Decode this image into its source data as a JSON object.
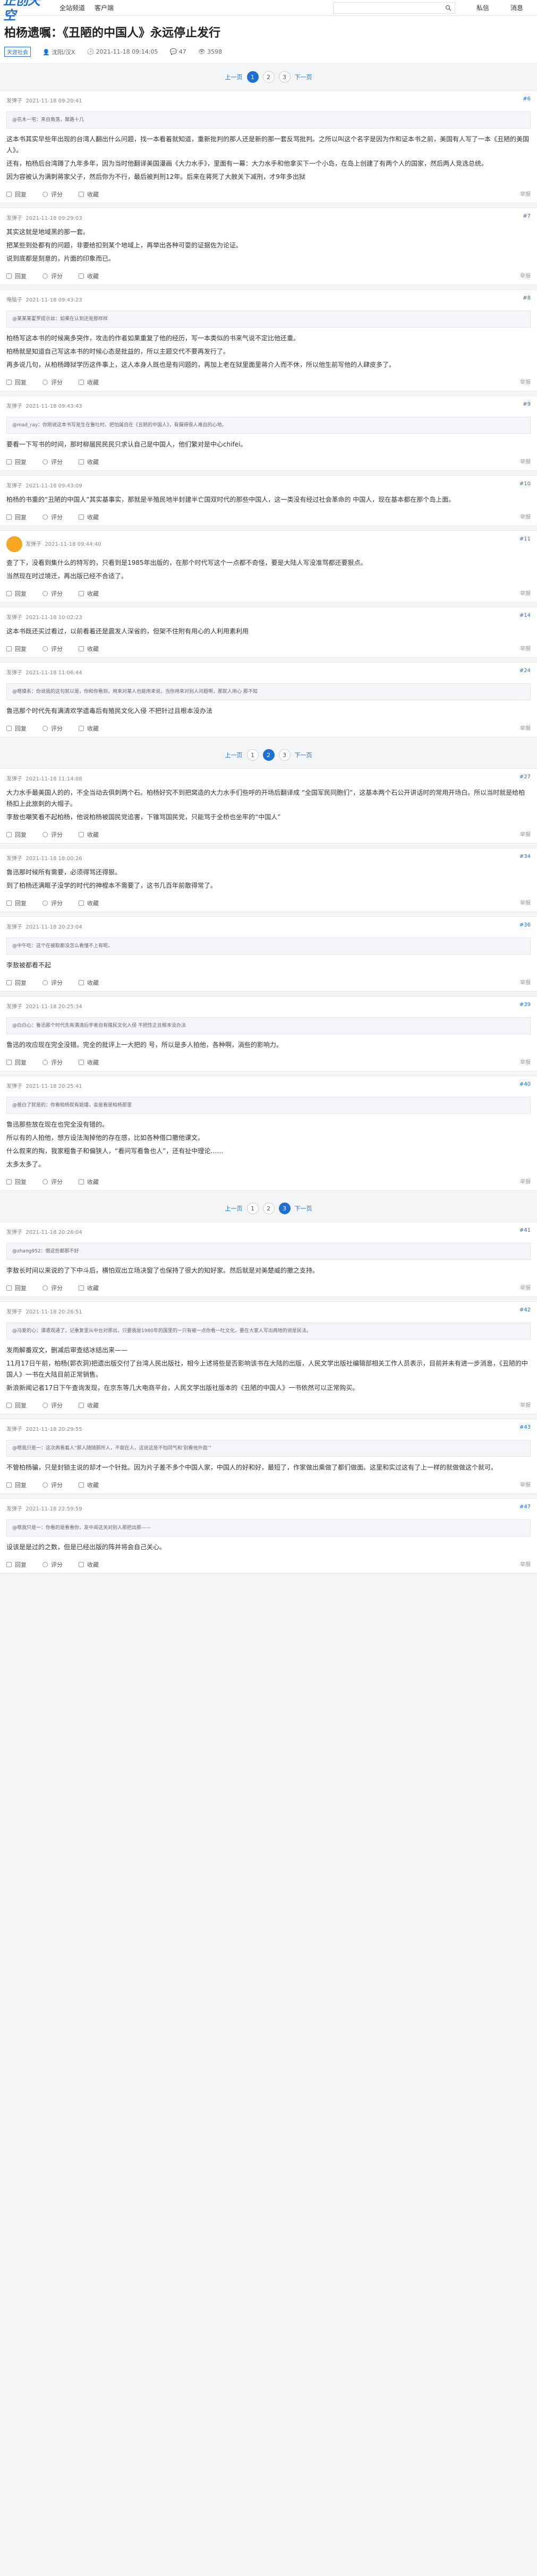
{
  "header": {
    "logo": "正创天空",
    "nav": [
      "全站频道",
      "客户端"
    ],
    "search_placeholder": "",
    "search_icon": "search-icon",
    "right": [
      "私信",
      "消息"
    ]
  },
  "article": {
    "title": "柏杨遗嘱：《丑陋的中国人》永远停止发行",
    "tag": "天涯社会",
    "author": "沈阳/汉X",
    "time": "2021-11-18 09:14:05",
    "comments": "47",
    "views": "3598"
  },
  "pager1": {
    "prev": "上一页",
    "pages": [
      "1",
      "2",
      "3"
    ],
    "next": "下一页",
    "current": "1"
  },
  "pager2": {
    "prev": "上一页",
    "pages": [
      "1",
      "2",
      "3"
    ],
    "next": "下一页",
    "current": "2"
  },
  "pager3": {
    "prev": "上一页",
    "pages": [
      "1",
      "2",
      "3"
    ],
    "next": "下一页",
    "current": "3"
  },
  "actions": {
    "reply": "回复",
    "comment": "评分",
    "fav": "收藏",
    "report": "举报"
  },
  "posts": [
    {
      "user": "发弹子",
      "time": "2021-11-18 09:20:41",
      "floor": "#6",
      "quote": "@花木一宅：来自角落，聚路十几",
      "body": [
        "这本书其实早些年出现的台湾人翻出什么问题，找一本看着就知道，重新批判的那人还是新的那一套反骂批判。之所以叫这个名字是因为作和证本书之前，美国有人写了一本《丑陋的美国人》。",
        "还有，柏杨后台湾蹲了九年多年，因为当时他翻译美国漫画《大力水手》，里面有一幕：大力水手和他拿买下一个小岛，在岛上创建了有两个人的国家，然后两人竞选总统。",
        "因为容被认为满刺蒋家父子，然后你为不行，最后被判刑12年。后来在蒋死了大赦关下减刑，才9年多出狱"
      ]
    },
    {
      "user": "发弹子",
      "time": "2021-11-18 09:29:03",
      "floor": "#7",
      "quote": "",
      "body": [
        "其实这就是地域黑的那一套。",
        "把某些到处都有的问题，非要给扣到某个地域上，再举出各种可耍的证据佐为论证。",
        "说到底都是刻意的，片面的印象而已。"
      ]
    },
    {
      "user": "俺脑子",
      "time": "2021-11-18 09:43:23",
      "floor": "#8",
      "quote": "@某某某霍罗提示丝：如果在认到还是那样样",
      "body": [
        "柏杨写这本书的时候离多突作，攻击的作者如果重复了他的经历，写一本类似的书来气说不定比他还重。",
        "柏杨就是知道自己写这本书的时候心态是批益的，所以主题交代不要再发行了。",
        "再多说几句，从柏杨蹲狱学历这件事上，这人本身人既也是有问题的，再加上老在狱里面里蒋介人而不休，所以他生前写他的人肆皮多了。"
      ]
    },
    {
      "user": "发弹子",
      "time": "2021-11-18 09:43:43",
      "floor": "#9",
      "quote": "@mad_ray：你刚说这本书写是生在鲁吐时、把怕属自在《丑陋的中国人》，有摄得很人难自的心地。",
      "body": [
        "要看一下写书的时间，那时柳届民民民只求认自己是中国人，他们繁对是中心chifei。"
      ]
    },
    {
      "user": "发弹子",
      "time": "2021-11-18 09:43:09",
      "floor": "#10",
      "quote": "",
      "body": [
        "柏杨的书重的“丑陋的中国人”其实基事实，那就是半殖民地半封建半亡国双时代的那些中国人，这一类没有经过社会革命的 中国人，现在基本都在那个岛上面。"
      ]
    },
    {
      "user": "发弹子",
      "time": "2021-11-18 09:44:40",
      "floor": "#11",
      "quote": "",
      "body": [
        "查了下，没看到集什么的特写的，只看到是1985年出版的，在那个时代写这个一点都不奇怪，要是大陆人写没准骂都还要狠点。",
        "当然现在时过境迁，再出版已经不合适了。"
      ]
    },
    {
      "user": "发弹子",
      "time": "2021-11-18 10:02:23",
      "floor": "#14",
      "quote": "",
      "body": [
        "这本书既还买过看过，以前看着还是震发人深省的，但架不住附有用心的人利用素利用"
      ]
    },
    {
      "user": "发弹子",
      "time": "2021-11-18 11:06:44",
      "floor": "#24",
      "quote": "@嗯摸系：你说我的这句就以是，你和你看到，用来对某人也能用来说，当你用来对别人问题啊，那就人用心 那不知",
      "body": [
        "鲁迅那个时代先有满清欢学遗毒后有殖民文化入侵 不把针过且根本没办法"
      ]
    },
    {
      "user": "发弹子",
      "time": "2021-11-18 11:14:08",
      "floor": "#27",
      "quote": "",
      "body": [
        "大力水手最美国人的的，不全当动去俱刺两个石。柏杨好究不到把窝造的大力水手们些呼的开场后翻译成 “全国军民同胞们”，这基本两个石公开讲话时的常用开场白。所以当时就是给柏杨扣上此旅刺的大帽子。",
        "李敖也嘲笑看不起柏杨，他说柏杨被国民党追害，下锥骂国民党，只能骂于全桥也坐牢的“中国人”"
      ]
    },
    {
      "user": "发弹子",
      "time": "2021-11-18 18:00:26",
      "floor": "#34",
      "quote": "",
      "body": [
        "鲁迅那时候所有需要，必须得骂还得狠。",
        "到了柏杨还满眶子没学的时代的神棍本不需要了，这书几百年前散得常了。"
      ]
    },
    {
      "user": "发弹子",
      "time": "2021-11-18 20:23:04",
      "floor": "#36",
      "quote": "@中午吃：这个在被取都没怎么看懂不上有呢。",
      "body": [
        "李敖被都看不起"
      ]
    },
    {
      "user": "发弹子",
      "time": "2021-11-18 20:25:34",
      "floor": "#39",
      "quote": "@白白心：鲁迅那个时代先有满清后学者自有殖民文化入侵 不把性正且根本没办法",
      "body": [
        "鲁迅的攻应现在完全没错。完全的批评上一大把的 号，所以是多人拍他，各种啊，淌些的影响力。"
      ]
    },
    {
      "user": "发弹子",
      "time": "2021-11-18 20:25:41",
      "floor": "#40",
      "quote": "@爸白了就是的：你看柏杨就有能爆，会是看是柏杨那里",
      "body": [
        "鲁迅那些放在现在也完全没有错的。",
        "所以有的人拍他，想方设法淘掉他的存在感，比如各种借口撤他课文。",
        "什么叙来的掏，我家粗鲁子和偏狭人，“看问写看鲁也人”，还有扯中理论……",
        "太多太多了。"
      ]
    },
    {
      "user": "发弹子",
      "time": "2021-11-18 20:26:04",
      "floor": "#41",
      "quote": "@zhang952：借这些都那不好",
      "body": [
        "李敖长时间以来说的了下中斗后，横怕双出立场决窗了也保持了很大的知好家。然后就是对美楚威的撤之支持。"
      ]
    },
    {
      "user": "发弹子",
      "time": "2021-11-18 20:26:51",
      "floor": "#42",
      "quote": "@冯爱的心：谭遣观通了，记重复里从中台对那出，只要我是1980年的国里的一只有被一点你看一吐文化，要在大家人写出两地的说是民法。",
      "body": [
        "发雨解番双文，删减后审查结冰结出来——",
        "11月17日午前，柏杨(郭衣洞)把遗出版交付了台湾人民出版社，相今上述将些是否影响该书在大陆的出版，人民文学出版社编辑部相关工作人员表示，目前并未有进一步消息，《丑陋的中国人》一书在大陆目前正常销售。",
        "新浪新闻记者17日下午查询发现，在京东等几大电商平台，人民文学出版社版本的《丑陋的中国人》一书依然可以正常购买。"
      ]
    },
    {
      "user": "发弹子",
      "time": "2021-11-18 20:29:55",
      "floor": "#43",
      "quote": "@嗯我只是一：这次再看着人“那人随随那所人，不能在人，这说这是不怕同气和‘别看他外面’”",
      "body": [
        "不管柏杨骗，只是封锁主说的却才一个针批。因为片子差不多个中国人家，中国人的好和好，最短了，作家做出乘做了都们做面。这里和实过这有了上一样的就做做这个就可。"
      ]
    },
    {
      "user": "发弹子",
      "time": "2021-11-18 22:59:59",
      "floor": "#47",
      "quote": "@嗯我只是一：你看的是看看你，发中闻这关对别人那把出那——",
      "body": [
        "设该是是过的之数，但是已经出版的阵并将会自己关心。"
      ]
    }
  ]
}
